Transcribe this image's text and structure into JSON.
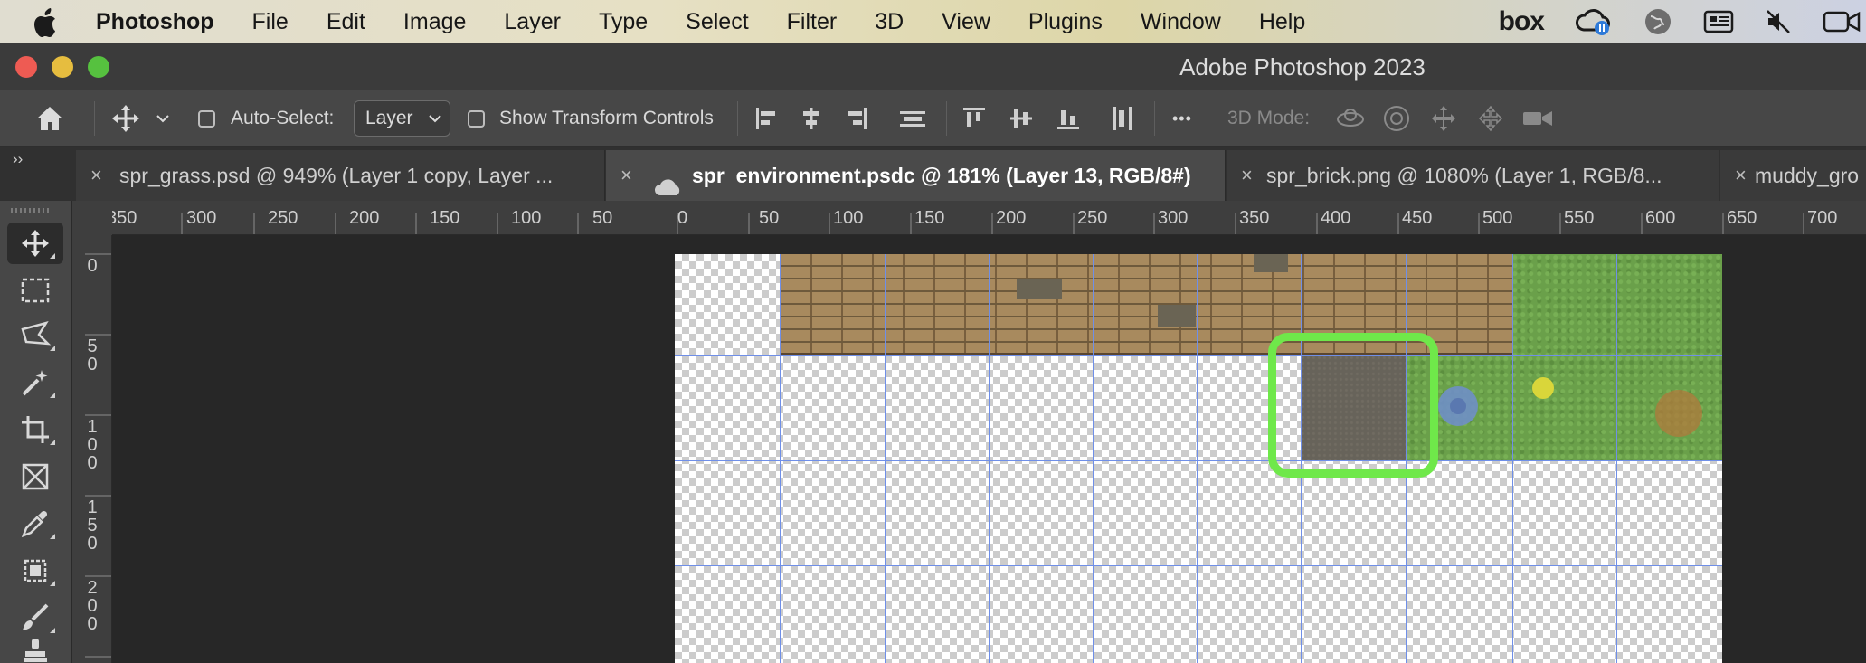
{
  "menubar": {
    "app_name": "Photoshop",
    "items": [
      "File",
      "Edit",
      "Image",
      "Layer",
      "Type",
      "Select",
      "Filter",
      "3D",
      "View",
      "Plugins",
      "Window",
      "Help"
    ],
    "status_icons": [
      "box-logo",
      "creative-cloud-icon",
      "globe-icon",
      "news-icon",
      "mute-icon",
      "video-icon"
    ],
    "box_label": "box"
  },
  "window": {
    "title": "Adobe Photoshop 2023"
  },
  "options_bar": {
    "auto_select_label": "Auto-Select:",
    "auto_select_value": "Layer",
    "show_transform_label": "Show Transform Controls",
    "more_label": "•••",
    "mode_3d_label": "3D Mode:"
  },
  "tabs": [
    {
      "label": "spr_grass.psd @ 949% (Layer 1 copy, Layer ...",
      "active": false
    },
    {
      "label": "spr_environment.psdc @ 181% (Layer 13, RGB/8#)",
      "active": true,
      "cloud": true
    },
    {
      "label": "spr_brick.png @ 1080% (Layer 1, RGB/8...",
      "active": false
    },
    {
      "label": "muddy_gro",
      "active": false
    }
  ],
  "panel_toggle": "››",
  "tab_close_glyph": "×",
  "tools": [
    "move-tool",
    "marquee-tool",
    "lasso-tool",
    "magic-wand-tool",
    "crop-tool",
    "frame-tool",
    "eyedropper-tool",
    "patch-tool",
    "brush-tool",
    "stamp-tool"
  ],
  "ruler_top": [
    "350",
    "300",
    "250",
    "200",
    "150",
    "100",
    "50",
    "0",
    "50",
    "100",
    "150",
    "200",
    "250",
    "300",
    "350",
    "400",
    "450",
    "500",
    "550",
    "600",
    "650",
    "700"
  ],
  "ruler_left": [
    "0",
    "5\n0",
    "1\n0\n0",
    "1\n5\n0",
    "2\n0\n0"
  ],
  "colors": {
    "accent_highlight": "#6fe84a",
    "guide_blue": "#6f8fe8",
    "toolbar_bg": "#474747"
  }
}
